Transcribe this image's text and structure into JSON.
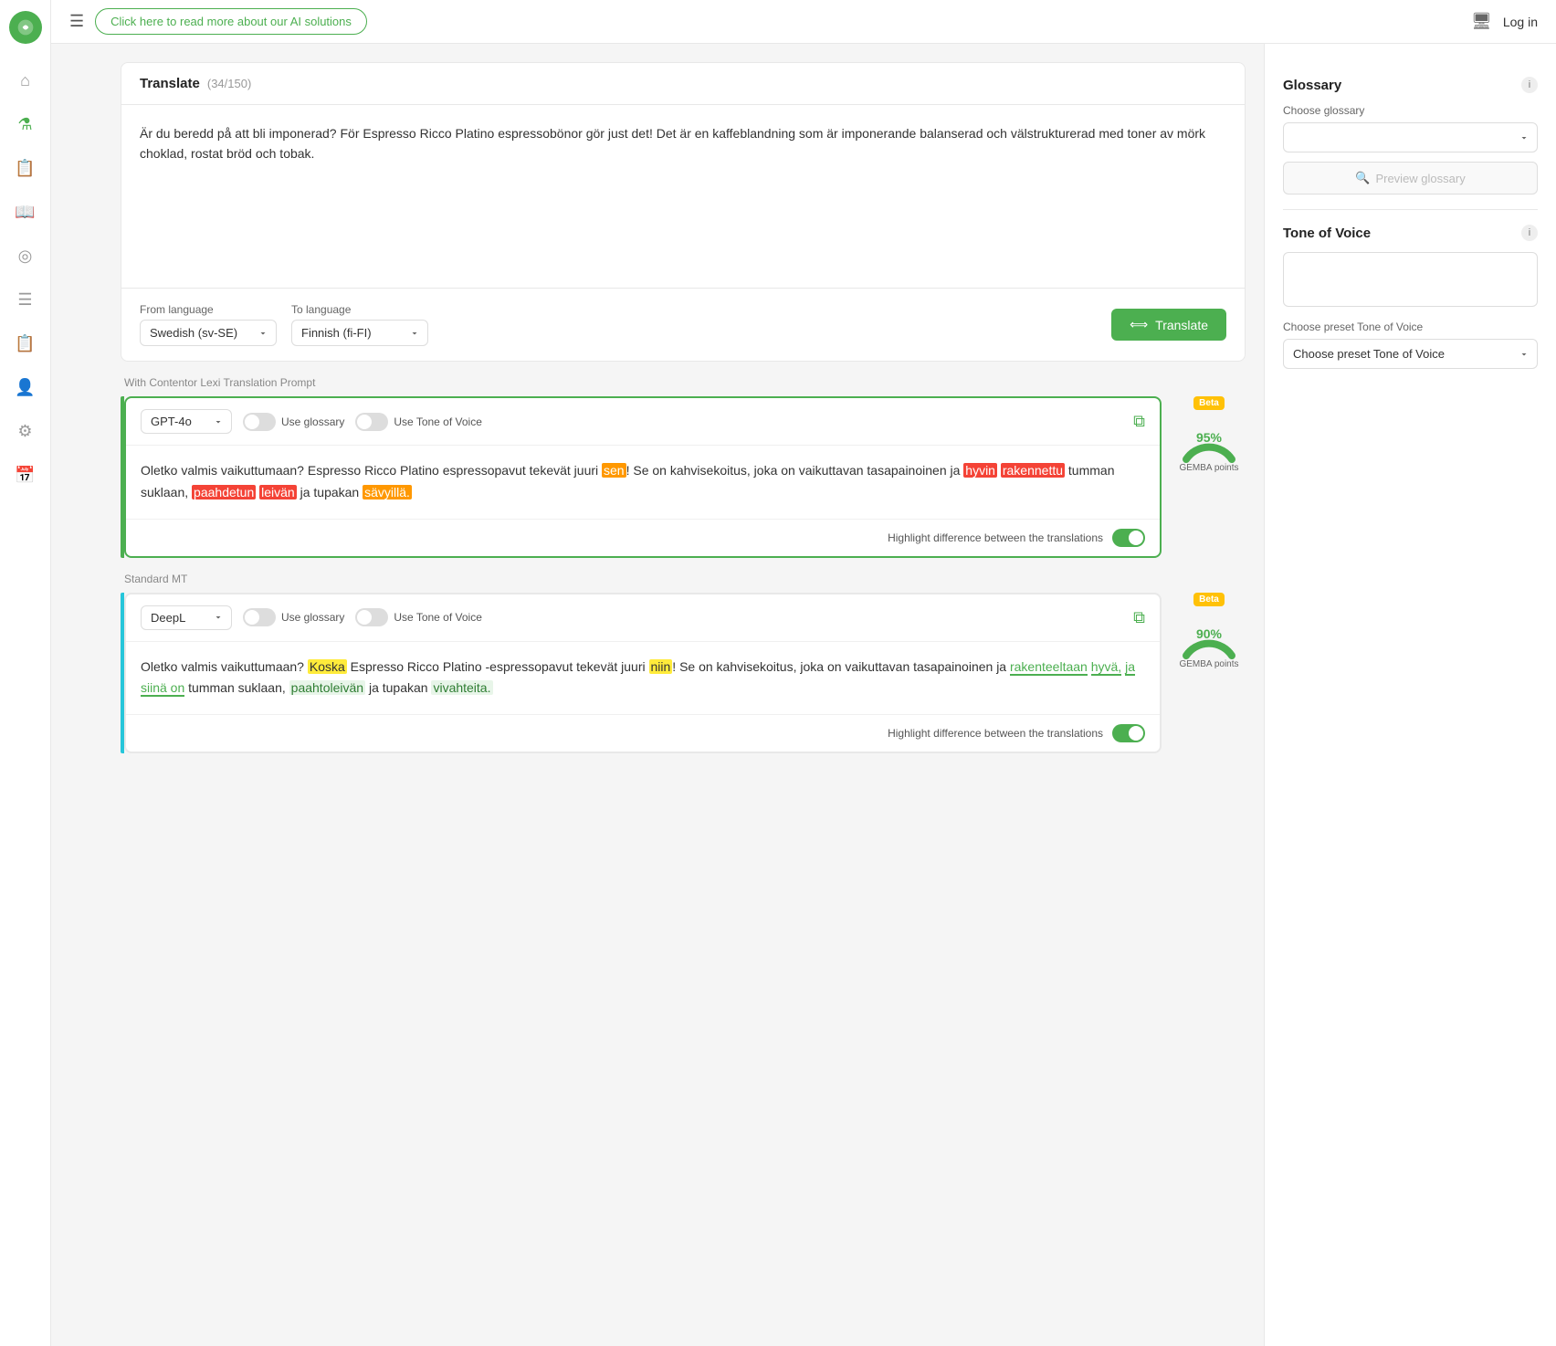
{
  "topbar": {
    "ai_btn_label": "Click here to read more about our AI solutions",
    "login_label": "Log in",
    "menu_icon": "☰"
  },
  "sidebar": {
    "items": [
      {
        "icon": "⌂",
        "label": "Home",
        "active": false
      },
      {
        "icon": "⚗",
        "label": "Lab",
        "active": true
      },
      {
        "icon": "📋",
        "label": "Documents",
        "active": false
      },
      {
        "icon": "📖",
        "label": "Book",
        "active": false
      },
      {
        "icon": "◎",
        "label": "Analytics",
        "active": false
      },
      {
        "icon": "≡",
        "label": "List",
        "active": false
      },
      {
        "icon": "📋",
        "label": "Reports",
        "active": false
      },
      {
        "icon": "👤",
        "label": "User",
        "active": false
      },
      {
        "icon": "⚙",
        "label": "Settings",
        "active": false
      },
      {
        "icon": "📅",
        "label": "Calendar",
        "active": false
      }
    ]
  },
  "translate": {
    "title": "Translate",
    "count": "(34/150)",
    "source_text": "Är du beredd på att bli imponerad? För Espresso Ricco Platino espressobönor gör just det! Det är en kaffeblandning som är imponerande balanserad och välstrukturerad med toner av mörk choklad, rostat bröd och tobak.",
    "from_language_label": "From language",
    "from_language_value": "Swedish (sv-SE)",
    "to_language_label": "To language",
    "to_language_value": "Finnish (fi-FI)",
    "translate_btn": "Translate"
  },
  "results": {
    "section1_label": "With Contentor Lexi Translation Prompt",
    "section2_label": "Standard MT",
    "result1": {
      "model": "GPT-4o",
      "use_glossary_label": "Use glossary",
      "use_tone_label": "Use Tone of Voice",
      "glossary_on": false,
      "tone_on": false,
      "text_parts": [
        {
          "text": "Oletko valmis vaikuttumaan? Espresso Ricco Platino espressopavut tekevät juuri ",
          "type": "normal"
        },
        {
          "text": "sen",
          "type": "orange"
        },
        {
          "text": "! Se on kahvisekoitus, joka on vaikuttavan tasapainoinen ja ",
          "type": "normal"
        },
        {
          "text": "hyvin",
          "type": "red"
        },
        {
          "text": " ",
          "type": "normal"
        },
        {
          "text": "rakennettu",
          "type": "red"
        },
        {
          "text": " tumman suklaan, ",
          "type": "normal"
        },
        {
          "text": "paahdetun",
          "type": "red"
        },
        {
          "text": " ",
          "type": "normal"
        },
        {
          "text": "leivän",
          "type": "red"
        },
        {
          "text": " ja tupakan ",
          "type": "normal"
        },
        {
          "text": "sävyillä.",
          "type": "orange"
        }
      ],
      "highlight_diff_label": "Highlight difference between the translations",
      "highlight_diff_on": true,
      "gemba_pct": "95%",
      "gemba_label": "GEMBA points",
      "beta_label": "Beta"
    },
    "result2": {
      "model": "DeepL",
      "use_glossary_label": "Use glossary",
      "use_tone_label": "Use Tone of Voice",
      "glossary_on": false,
      "tone_on": false,
      "text_parts": [
        {
          "text": "Oletko valmis vaikuttumaan? ",
          "type": "normal"
        },
        {
          "text": "Koska",
          "type": "yellow"
        },
        {
          "text": " Espresso Ricco Platino ",
          "type": "normal"
        },
        {
          "text": "-",
          "type": "normal"
        },
        {
          "text": "espressopavut tekevät juuri ",
          "type": "normal"
        },
        {
          "text": "niin",
          "type": "yellow"
        },
        {
          "text": "! Se on kahvisekoitus, joka on vaikuttavan tasapainoinen ja ",
          "type": "normal"
        },
        {
          "text": "rakenteeltaan",
          "type": "green-border"
        },
        {
          "text": " ",
          "type": "normal"
        },
        {
          "text": "hyvä,",
          "type": "green-border"
        },
        {
          "text": " ",
          "type": "normal"
        },
        {
          "text": "ja siinä on",
          "type": "green-border"
        },
        {
          "text": " tumman suklaan, ",
          "type": "normal"
        },
        {
          "text": "paahtoleivän",
          "type": "green-bg"
        },
        {
          "text": " ja tupakan ",
          "type": "normal"
        },
        {
          "text": "vivahteita.",
          "type": "green-bg"
        }
      ],
      "highlight_diff_label": "Highlight difference between the translations",
      "highlight_diff_on": true,
      "gemba_pct": "90%",
      "gemba_label": "GEMBA points",
      "beta_label": "Beta"
    }
  },
  "glossary": {
    "title": "Glossary",
    "choose_label": "Choose glossary",
    "choose_placeholder": "",
    "preview_btn": "Preview glossary",
    "info_icon": "i"
  },
  "tone_of_voice": {
    "title": "Tone of Voice",
    "choose_label": "Choose preset Tone of Voice",
    "choose_placeholder": "Choose preset Tone of Voice",
    "info_icon": "i"
  }
}
